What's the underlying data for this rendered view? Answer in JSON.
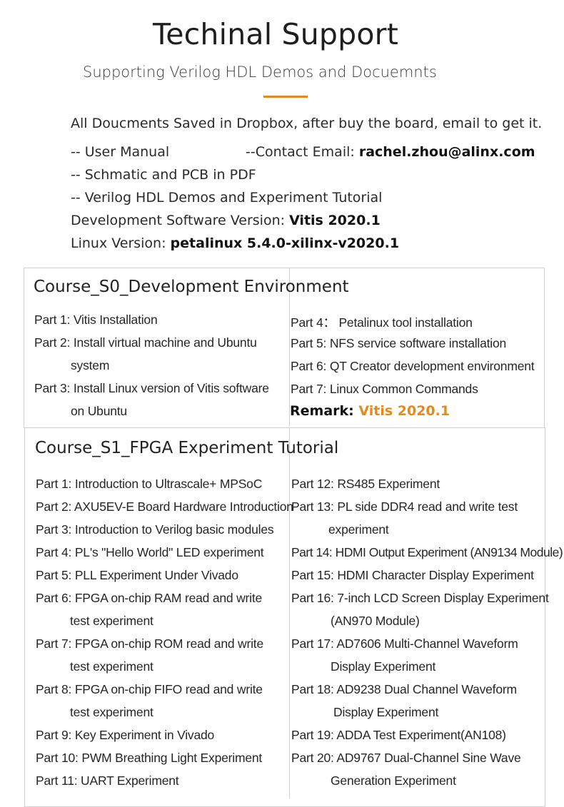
{
  "header": {
    "title": "Techinal Support",
    "subtitle": "Supporting Verilog HDL Demos and Docuemnts",
    "accent_color": "#e38a1f"
  },
  "intro": {
    "saved_note": "All Doucments Saved in Dropbox, after buy the board, email to get it.",
    "user_manual": "-- User Manual",
    "contact_label": "--Contact Email: ",
    "contact_email": "rachel.zhou@alinx.com",
    "schematic": "-- Schmatic and PCB in PDF",
    "demos": "--  Verilog HDL Demos and Experiment Tutorial",
    "dev_sw_label": "Development Software Version: ",
    "dev_sw_value": "Vitis 2020.1",
    "linux_label": "Linux Version: ",
    "linux_value": "petalinux 5.4.0-xilinx-v2020.1"
  },
  "course_s0": {
    "title": "Course_S0_Development Environment",
    "left": [
      "Part 1: Vitis Installation",
      "Part 2: Install virtual machine and Ubuntu",
      "system",
      "Part 3: Install Linux version of Vitis software",
      "on Ubuntu"
    ],
    "right": [
      "Part 4：  Petalinux tool installation",
      "Part 5: NFS service software installation",
      "Part 6: QT Creator development environment",
      "Part 7: Linux Common Commands"
    ],
    "remark_label": "Remark: ",
    "remark_value": "Vitis 2020.1"
  },
  "course_s1": {
    "title": "Course_S1_FPGA Experiment Tutorial",
    "left": [
      "Part 1: Introduction to Ultrascale+ MPSoC",
      "Part 2: AXU5EV-E Board Hardware Introduction",
      "Part 3: Introduction to Verilog basic modules",
      "Part 4: PL's \"Hello World\" LED experiment",
      "Part 5: PLL Experiment Under Vivado",
      "Part 6: FPGA on-chip RAM read and write",
      "test experiment",
      "Part 7: FPGA on-chip ROM read and write",
      "test experiment",
      "Part 8: FPGA on-chip FIFO read and write",
      "test experiment",
      "Part 9: Key Experiment in Vivado",
      "Part 10: PWM Breathing Light Experiment",
      "Part 11: UART Experiment"
    ],
    "right": [
      "Part 12: RS485 Experiment",
      "Part 13: PL side DDR4 read and write test",
      "experiment",
      "Part 14: HDMI Output Experiment (AN9134 Module)",
      "Part 15: HDMI Character Display Experiment",
      "Part 16: 7-inch LCD Screen Display Experiment",
      "(AN970 Module)",
      "Part 17: AD7606 Multi-Channel Waveform",
      "Display Experiment",
      "Part 18: AD9238 Dual Channel Waveform",
      "Display Experiment",
      "Part 19: ADDA Test Experiment(AN108)",
      "Part 20: AD9767 Dual-Channel Sine Wave",
      "Generation Experiment"
    ]
  }
}
